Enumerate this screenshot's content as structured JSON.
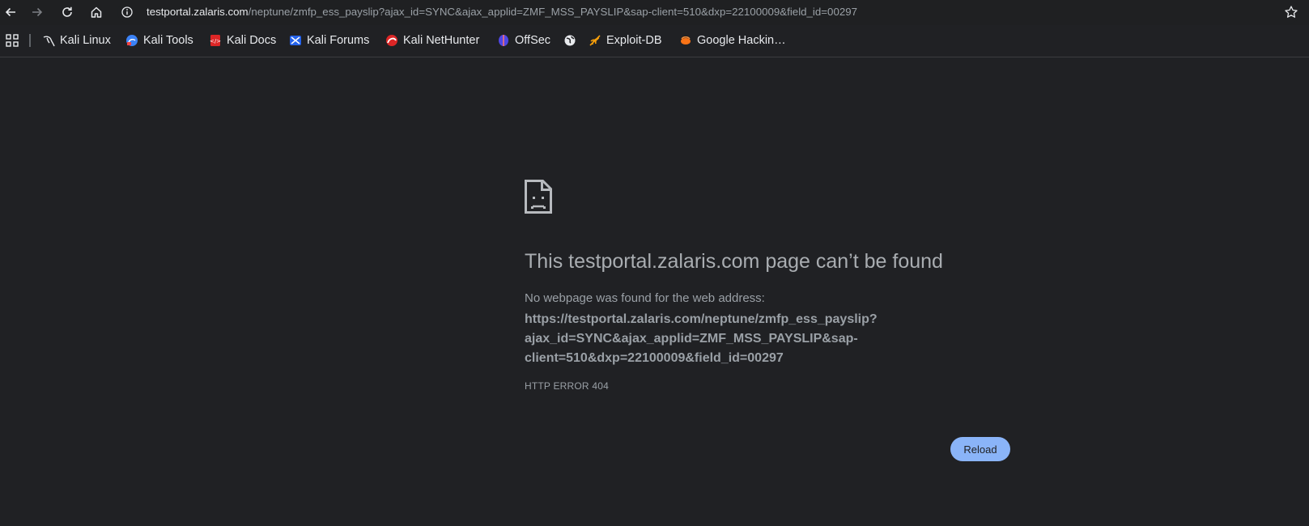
{
  "browser": {
    "url_host": "testportal.zalaris.com",
    "url_path": "/neptune/zmfp_ess_payslip?ajax_id=SYNC&ajax_applid=ZMF_MSS_PAYSLIP&sap-client=510&dxp=22100009&field_id=00297",
    "icons": {
      "back": "arrow-left-icon",
      "forward": "arrow-right-icon",
      "reload": "reload-icon",
      "home": "home-icon",
      "site_info": "info-icon",
      "bookmark": "star-icon",
      "apps": "apps-grid-icon"
    }
  },
  "bookmarks": [
    {
      "label": "Kali Linux",
      "icon": "kali-dragon-icon"
    },
    {
      "label": "Kali Tools",
      "icon": "kali-tools-icon"
    },
    {
      "label": "Kali Docs",
      "icon": "kali-docs-icon"
    },
    {
      "label": "Kali Forums",
      "icon": "kali-forums-icon"
    },
    {
      "label": "Kali NetHunter",
      "icon": "nethunter-icon"
    },
    {
      "label": "OffSec",
      "icon": "offsec-icon"
    },
    {
      "label": "",
      "icon": "globe-icon"
    },
    {
      "label": "Exploit-DB",
      "icon": "exploit-db-icon"
    },
    {
      "label": "Google Hackin…",
      "icon": "ghdb-icon"
    }
  ],
  "error": {
    "title": "This testportal.zalaris.com page can’t be found",
    "message": "No webpage was found for the web address:",
    "url_lines": [
      "https://testportal.zalaris.com/neptune/zmfp_ess_payslip?",
      "ajax_id=SYNC&ajax_applid=ZMF_MSS_PAYSLIP&sap-",
      "client=510&dxp=22100009&field_id=00297"
    ],
    "code": "HTTP ERROR 404",
    "reload_label": "Reload",
    "icon": "sad-page-icon"
  },
  "colors": {
    "background": "#202124",
    "text": "#9aa0a6",
    "accent": "#8ab4f8"
  }
}
